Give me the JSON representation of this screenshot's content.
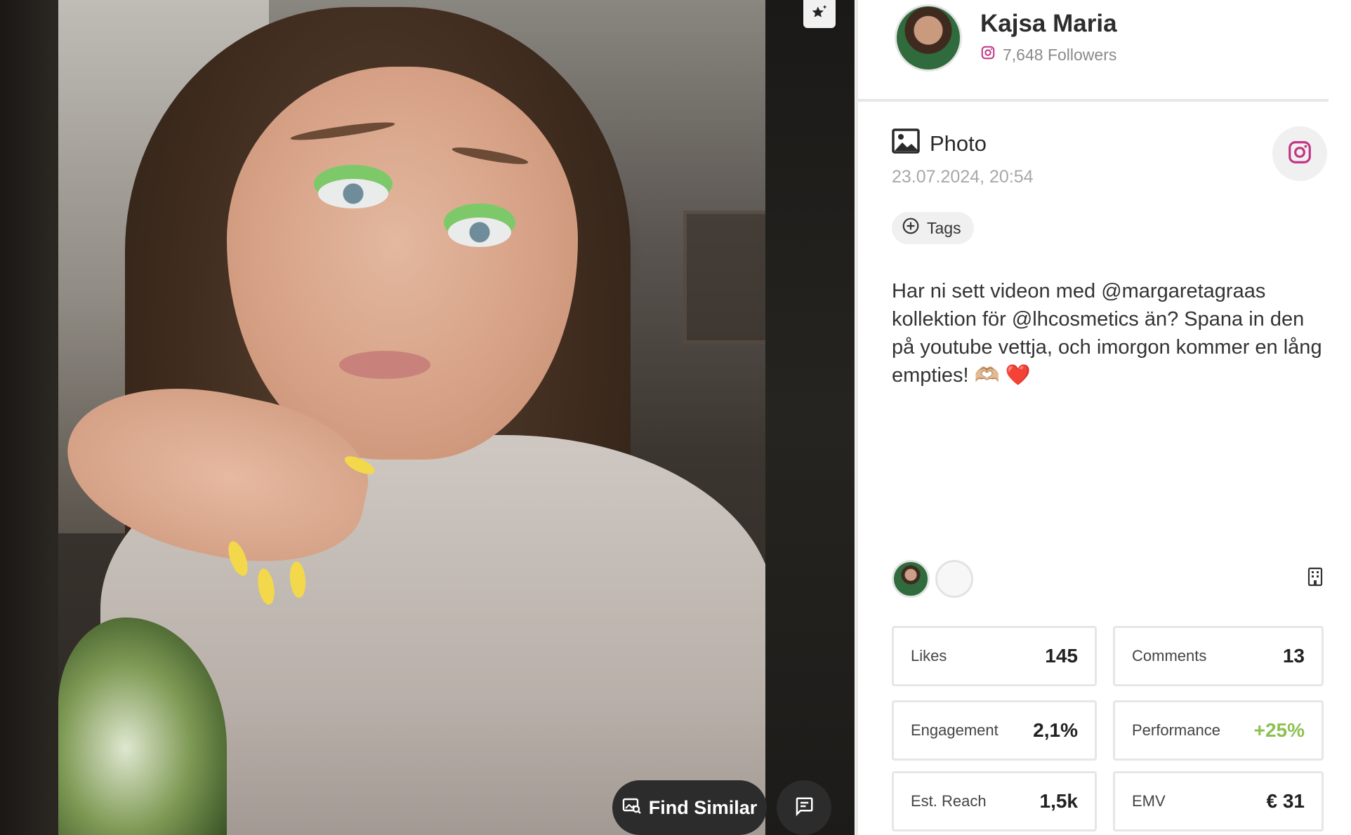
{
  "media": {
    "find_similar_label": "Find Similar",
    "icons": {
      "magic": "sparkle-star-icon",
      "find_similar": "image-search-icon",
      "comment": "comment-icon"
    }
  },
  "profile": {
    "name": "Kajsa Maria",
    "followers": "7,648 Followers",
    "platform_icon": "instagram-icon",
    "accent": "#c13584"
  },
  "post": {
    "type": "Photo",
    "type_icon": "image-icon",
    "date": "23.07.2024, 20:54",
    "tags_label": "Tags",
    "caption": "Har ni sett videon med @margaretagraas kollektion för @lhcosmetics än? Spana in den på youtube vettja, och imorgon kommer en lång empties! 🫶🏼 ❤️"
  },
  "stats": [
    {
      "label": "Likes",
      "value": "145"
    },
    {
      "label": "Comments",
      "value": "13"
    },
    {
      "label": "Engagement",
      "value": "2,1%"
    },
    {
      "label": "Performance",
      "value": "+25%"
    },
    {
      "label": "Est. Reach",
      "value": "1,5k"
    },
    {
      "label": "EMV",
      "value": "€ 31"
    }
  ],
  "colors": {
    "positive": "#8cc152",
    "instagram": "#c13584",
    "dark_button": "#2c2c2c"
  }
}
